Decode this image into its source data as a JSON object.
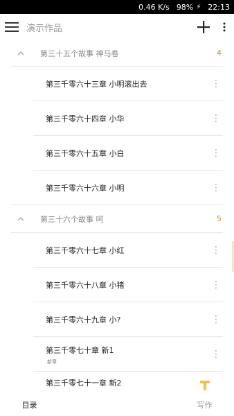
{
  "status": {
    "speed": "0.46 K/s",
    "battery": "98%",
    "time": "22:13"
  },
  "toolbar": {
    "title": "演示作品"
  },
  "colors": {
    "accent": "#d08a2a",
    "fab": "#f0c24b"
  },
  "groups": [
    {
      "title": "第三十五个故事 神马卷",
      "count": "4",
      "chapters": [
        {
          "title": "第三千零六十三章 小明滚出去"
        },
        {
          "title": "第三千零六十四章 小华"
        },
        {
          "title": "第三千零六十五章 小白"
        },
        {
          "title": "第三千零六十六章 小明"
        }
      ]
    },
    {
      "title": "第三十六个故事 呵",
      "count": "5",
      "chapters": [
        {
          "title": "第三千零六十七章 小红"
        },
        {
          "title": "第三千零六十八章 小猪"
        },
        {
          "title": "第三千零六十九章 小?"
        },
        {
          "title": "第三千零七十章 新1",
          "tag": "新章"
        },
        {
          "title": "第三千零七十一章 新2"
        }
      ]
    }
  ],
  "bottom_nav": {
    "tab_catalog": "目录",
    "tab_write": "写作"
  },
  "icons": {
    "menu": "menu-icon",
    "add": "plus-icon",
    "more": "more-vert-icon",
    "collapse": "chevron-up-icon",
    "kebab": "more-vert-icon",
    "fab": "text-icon"
  }
}
